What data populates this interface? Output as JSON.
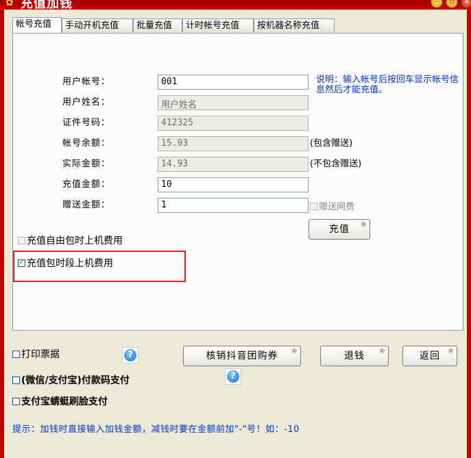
{
  "window": {
    "title": "充值加钱",
    "min_label": "–",
    "max_label": "▫",
    "close_label": "×"
  },
  "tabs": [
    "帐号充值",
    "手动开机充值",
    "批量充值",
    "计时帐号充值",
    "按机器名称充值"
  ],
  "form": {
    "account_label": "用户帐号：",
    "account_value": "001",
    "name_label": "用户姓名：",
    "name_value": "用户姓名",
    "id_label": "证件号码：",
    "id_value": "412325",
    "balance_label": "帐号余额：",
    "balance_value": "15.93",
    "balance_note": "(包含赠送)",
    "actual_label": "实际金额：",
    "actual_value": "14.93",
    "actual_note": "(不包含赠送)",
    "recharge_label": "充值金额：",
    "recharge_value": "10",
    "gift_label": "赠送金额：",
    "gift_value": "1",
    "gift_fee_label": "赠送网费",
    "note": "说明：输入帐号后按回车显示帐号信息然后才能充值。",
    "submit_label": "充值"
  },
  "options": {
    "free_package_label": "充值自由包时上机费用",
    "period_package_label": "充值包时段上机费用",
    "period_package_checked": true
  },
  "bottom": {
    "print_receipt": "打印票据",
    "wechat_alipay": "(微信/支付宝)付款码支付",
    "alipay_face": "支付宝蜻蜓刷脸支付",
    "douyin_button": "核销抖音团购券",
    "refund_button": "退钱",
    "back_button": "返回",
    "help_icon_label": "?",
    "hint": "提示：加钱时直接输入加钱金额，减钱时要在金额前加\"-\"号！如：-10"
  }
}
